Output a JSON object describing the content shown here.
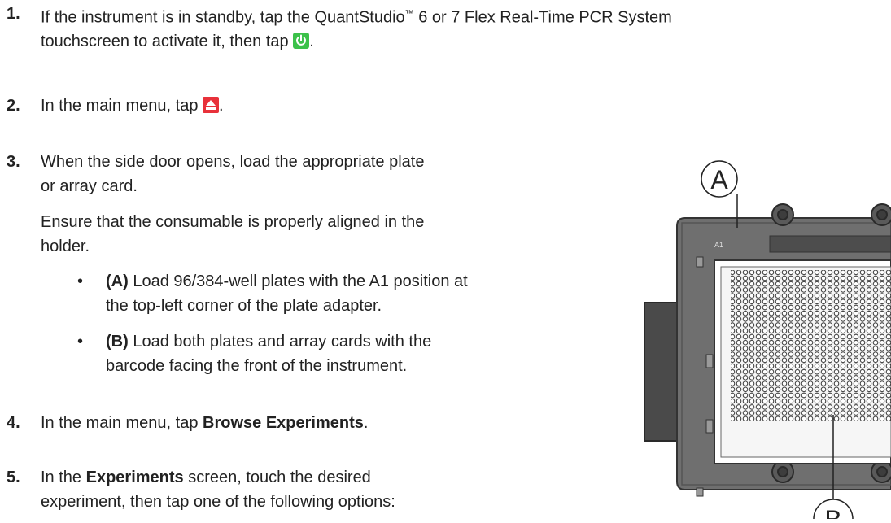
{
  "steps": [
    {
      "number": "1.",
      "line1_prefix": "If the instrument is in standby, tap the QuantStudio",
      "tm": "™",
      "line1_suffix": " 6 or 7 Flex Real-Time PCR System",
      "line2_prefix": "touchscreen to activate it, then tap ",
      "line2_suffix": ".",
      "icon": "power-icon"
    },
    {
      "number": "2.",
      "text_prefix": "In the main menu, tap ",
      "text_suffix": ".",
      "icon": "eject-icon"
    },
    {
      "number": "3.",
      "line1": "When the side door opens, load the appropriate plate",
      "line2": "or array card.",
      "para1": "Ensure that the consumable is properly aligned in the",
      "para2": "holder.",
      "bullets": [
        {
          "label": "(A)",
          "line1": " Load 96/384-well plates with the A1 position at",
          "line2": "the top-left corner of the plate adapter."
        },
        {
          "label": "(B)",
          "line1": " Load both plates and array cards with the",
          "line2": "barcode facing the front of the instrument."
        }
      ]
    },
    {
      "number": "4.",
      "prefix": "In the main menu, tap ",
      "bold": "Browse Experiments",
      "suffix": "."
    },
    {
      "number": "5.",
      "prefix": "In the ",
      "bold": "Experiments",
      "suffix": " screen, touch the desired",
      "line2": "experiment, then tap one of the following options:"
    }
  ],
  "figure": {
    "callout_a": "A",
    "callout_b": "B",
    "a1_mark": "A1"
  },
  "colors": {
    "power_icon": "#3cc14a",
    "eject_icon": "#e8313a",
    "text": "#222222"
  }
}
